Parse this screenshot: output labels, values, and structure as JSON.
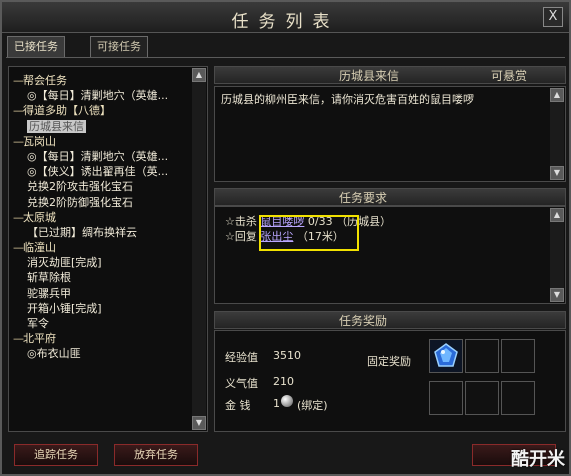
{
  "window": {
    "title": "任务列表",
    "close_label": "X"
  },
  "tabs": [
    {
      "label": "已接任务"
    },
    {
      "label": "可接任务"
    }
  ],
  "tree": [
    {
      "type": "cat",
      "label": "帮会任务"
    },
    {
      "type": "child",
      "label": "◎【每日】清剿地穴（英雄..."
    },
    {
      "type": "cat",
      "label": "得道多助【八德】"
    },
    {
      "type": "child",
      "label": "历城县来信",
      "selected": true
    },
    {
      "type": "cat",
      "label": "瓦岗山"
    },
    {
      "type": "child",
      "label": "◎【每日】清剿地穴（英雄..."
    },
    {
      "type": "child",
      "label": "◎【侠义】诱出翟再佳（英..."
    },
    {
      "type": "child",
      "label": "兑换2阶攻击强化宝石"
    },
    {
      "type": "child",
      "label": "兑换2阶防御强化宝石"
    },
    {
      "type": "cat",
      "label": "太原城"
    },
    {
      "type": "child",
      "label": "【已过期】绸布换祥云"
    },
    {
      "type": "cat",
      "label": "临潼山"
    },
    {
      "type": "child",
      "label": "消灭劫匪[完成]"
    },
    {
      "type": "child",
      "label": "斩草除根"
    },
    {
      "type": "child",
      "label": "驼骡兵甲"
    },
    {
      "type": "child",
      "label": "开箱小锤[完成]"
    },
    {
      "type": "child",
      "label": "军令"
    },
    {
      "type": "cat",
      "label": "北平府"
    },
    {
      "type": "child",
      "label": "◎布衣山匪"
    }
  ],
  "letter": {
    "header": "历城县来信",
    "shareable_label": "可悬赏",
    "text": "历城县的柳州臣来信，请你消灭危害百姓的鼠目喽啰"
  },
  "requirements": {
    "header": "任务要求",
    "lines": [
      {
        "prefix": "☆击杀",
        "link": "鼠目喽啰",
        "progress": "0/33",
        "suffix": "（历城县）"
      },
      {
        "prefix": "☆回复",
        "link": "张出尘",
        "progress": "",
        "suffix": "（17米）"
      }
    ]
  },
  "rewards": {
    "header": "任务奖励",
    "exp_label": "经验值",
    "exp_value": "3510",
    "yiqi_label": "义气值",
    "yiqi_value": "210",
    "money_label": "金 钱",
    "money_value": "1",
    "money_bind": "(绑定)",
    "fixed_label": "固定奖励"
  },
  "buttons": {
    "track": "追踪任务",
    "abandon": "放弃任务"
  },
  "watermark": "酷开米"
}
